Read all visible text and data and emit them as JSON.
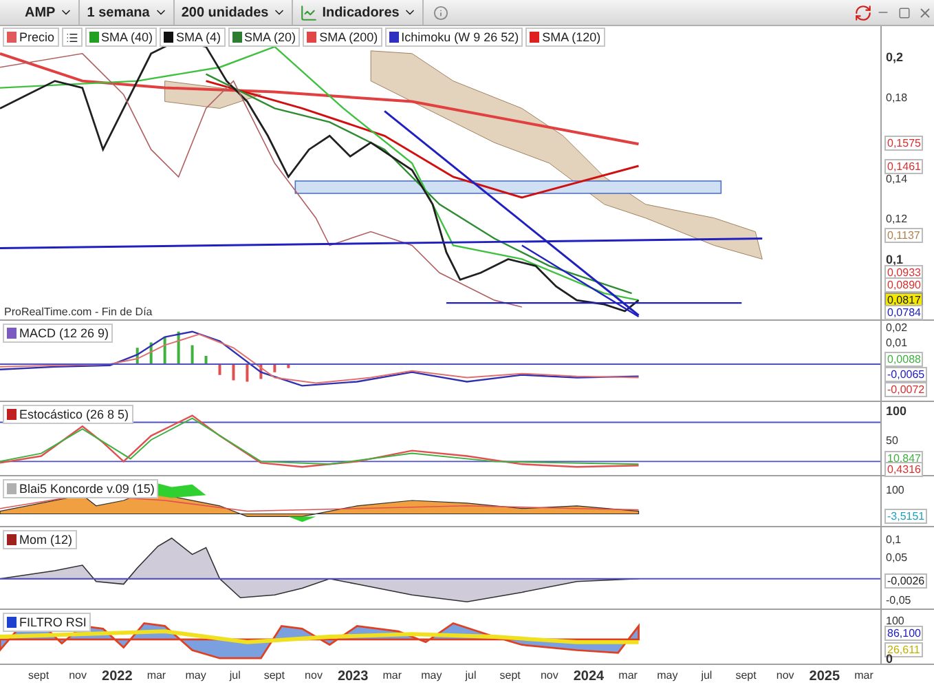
{
  "toolbar": {
    "dropdowns": [
      {
        "label": "AMP",
        "kind": "plain"
      },
      {
        "label": "1 semana",
        "kind": "plain"
      },
      {
        "label": "200 unidades",
        "kind": "plain"
      },
      {
        "label": "Indicadores",
        "kind": "indicators"
      }
    ]
  },
  "legend": [
    {
      "label": "Precio",
      "color": "#e05a5a"
    },
    {
      "label": "SMA (40)",
      "color": "#22a022"
    },
    {
      "label": "SMA (4)",
      "color": "#111111"
    },
    {
      "label": "SMA (20)",
      "color": "#2e7d32"
    },
    {
      "label": "SMA (200)",
      "color": "#e04848"
    },
    {
      "label": "Ichimoku (W 9 26 52)",
      "color": "#3030c0"
    },
    {
      "label": "SMA (120)",
      "color": "#e02020"
    }
  ],
  "main_panel": {
    "source": "ProRealTime.com - Fin de Día",
    "axis": [
      {
        "text": "0,2",
        "kind": "major"
      },
      {
        "text": "0,18",
        "kind": "tick"
      },
      {
        "text": "0,1575",
        "kind": "value",
        "color": "#d83030"
      },
      {
        "text": "0,1461",
        "kind": "value",
        "color": "#d83030"
      },
      {
        "text": "0,14",
        "kind": "tick"
      },
      {
        "text": "0,12",
        "kind": "tick"
      },
      {
        "text": "0,1137",
        "kind": "value",
        "color": "#b08050"
      },
      {
        "text": "0,1",
        "kind": "major"
      },
      {
        "text": "0,0933",
        "kind": "value",
        "color": "#d83030"
      },
      {
        "text": "0,0890",
        "kind": "value",
        "color": "#d83030"
      },
      {
        "text": "0,0817",
        "kind": "current"
      },
      {
        "text": "0,0784",
        "kind": "value",
        "color": "#2020c0"
      }
    ]
  },
  "panels": [
    {
      "kind": "macd",
      "title": "MACD (12 26 9)",
      "color": "#7a5cc0",
      "axis": [
        {
          "text": "0,02",
          "kind": "tick"
        },
        {
          "text": "0,01",
          "kind": "tick"
        },
        {
          "text": "0,0088",
          "kind": "value",
          "color": "#40b040"
        },
        {
          "text": "-0,0065",
          "kind": "value",
          "color": "#2020c0"
        },
        {
          "text": "-0,0072",
          "kind": "value",
          "color": "#d83030"
        }
      ]
    },
    {
      "kind": "stochastic",
      "title": "Estocástico (26 8 5)",
      "color": "#c02020",
      "axis": [
        {
          "text": "100",
          "kind": "major"
        },
        {
          "text": "50",
          "kind": "tick"
        },
        {
          "text": "10,847",
          "kind": "value",
          "color": "#40b040"
        },
        {
          "text": "0,4316",
          "kind": "value",
          "color": "#d83030"
        }
      ]
    },
    {
      "kind": "koncorde",
      "title": "Blai5 Koncorde v.09 (15)",
      "color": "#b0b0b0",
      "axis": [
        {
          "text": "100",
          "kind": "tick"
        },
        {
          "text": "-3,5151",
          "kind": "value",
          "color": "#20a0c0"
        }
      ]
    },
    {
      "kind": "momentum",
      "title": "Mom (12)",
      "color": "#a02020",
      "axis": [
        {
          "text": "0,1",
          "kind": "tick"
        },
        {
          "text": "0,05",
          "kind": "tick"
        },
        {
          "text": "-0,0026",
          "kind": "value",
          "color": "#202020"
        },
        {
          "text": "-0,05",
          "kind": "tick"
        }
      ]
    },
    {
      "kind": "rsi",
      "title": "FILTRO RSI",
      "color": "#2040d0",
      "axis": [
        {
          "text": "100",
          "kind": "tick"
        },
        {
          "text": "86,100",
          "kind": "value",
          "color": "#2020c0"
        },
        {
          "text": "26,611",
          "kind": "value",
          "color": "#c0b000"
        },
        {
          "text": "0",
          "kind": "major"
        }
      ]
    }
  ],
  "date_axis": [
    {
      "label": "sept",
      "kind": "month"
    },
    {
      "label": "nov",
      "kind": "month"
    },
    {
      "label": "2022",
      "kind": "year"
    },
    {
      "label": "mar",
      "kind": "month"
    },
    {
      "label": "may",
      "kind": "month"
    },
    {
      "label": "jul",
      "kind": "month"
    },
    {
      "label": "sept",
      "kind": "month"
    },
    {
      "label": "nov",
      "kind": "month"
    },
    {
      "label": "2023",
      "kind": "year"
    },
    {
      "label": "mar",
      "kind": "month"
    },
    {
      "label": "may",
      "kind": "month"
    },
    {
      "label": "jul",
      "kind": "month"
    },
    {
      "label": "sept",
      "kind": "month"
    },
    {
      "label": "nov",
      "kind": "month"
    },
    {
      "label": "2024",
      "kind": "year"
    },
    {
      "label": "mar",
      "kind": "month"
    },
    {
      "label": "may",
      "kind": "month"
    },
    {
      "label": "jul",
      "kind": "month"
    },
    {
      "label": "sept",
      "kind": "month"
    },
    {
      "label": "nov",
      "kind": "month"
    },
    {
      "label": "2025",
      "kind": "year"
    },
    {
      "label": "mar",
      "kind": "month"
    }
  ]
}
